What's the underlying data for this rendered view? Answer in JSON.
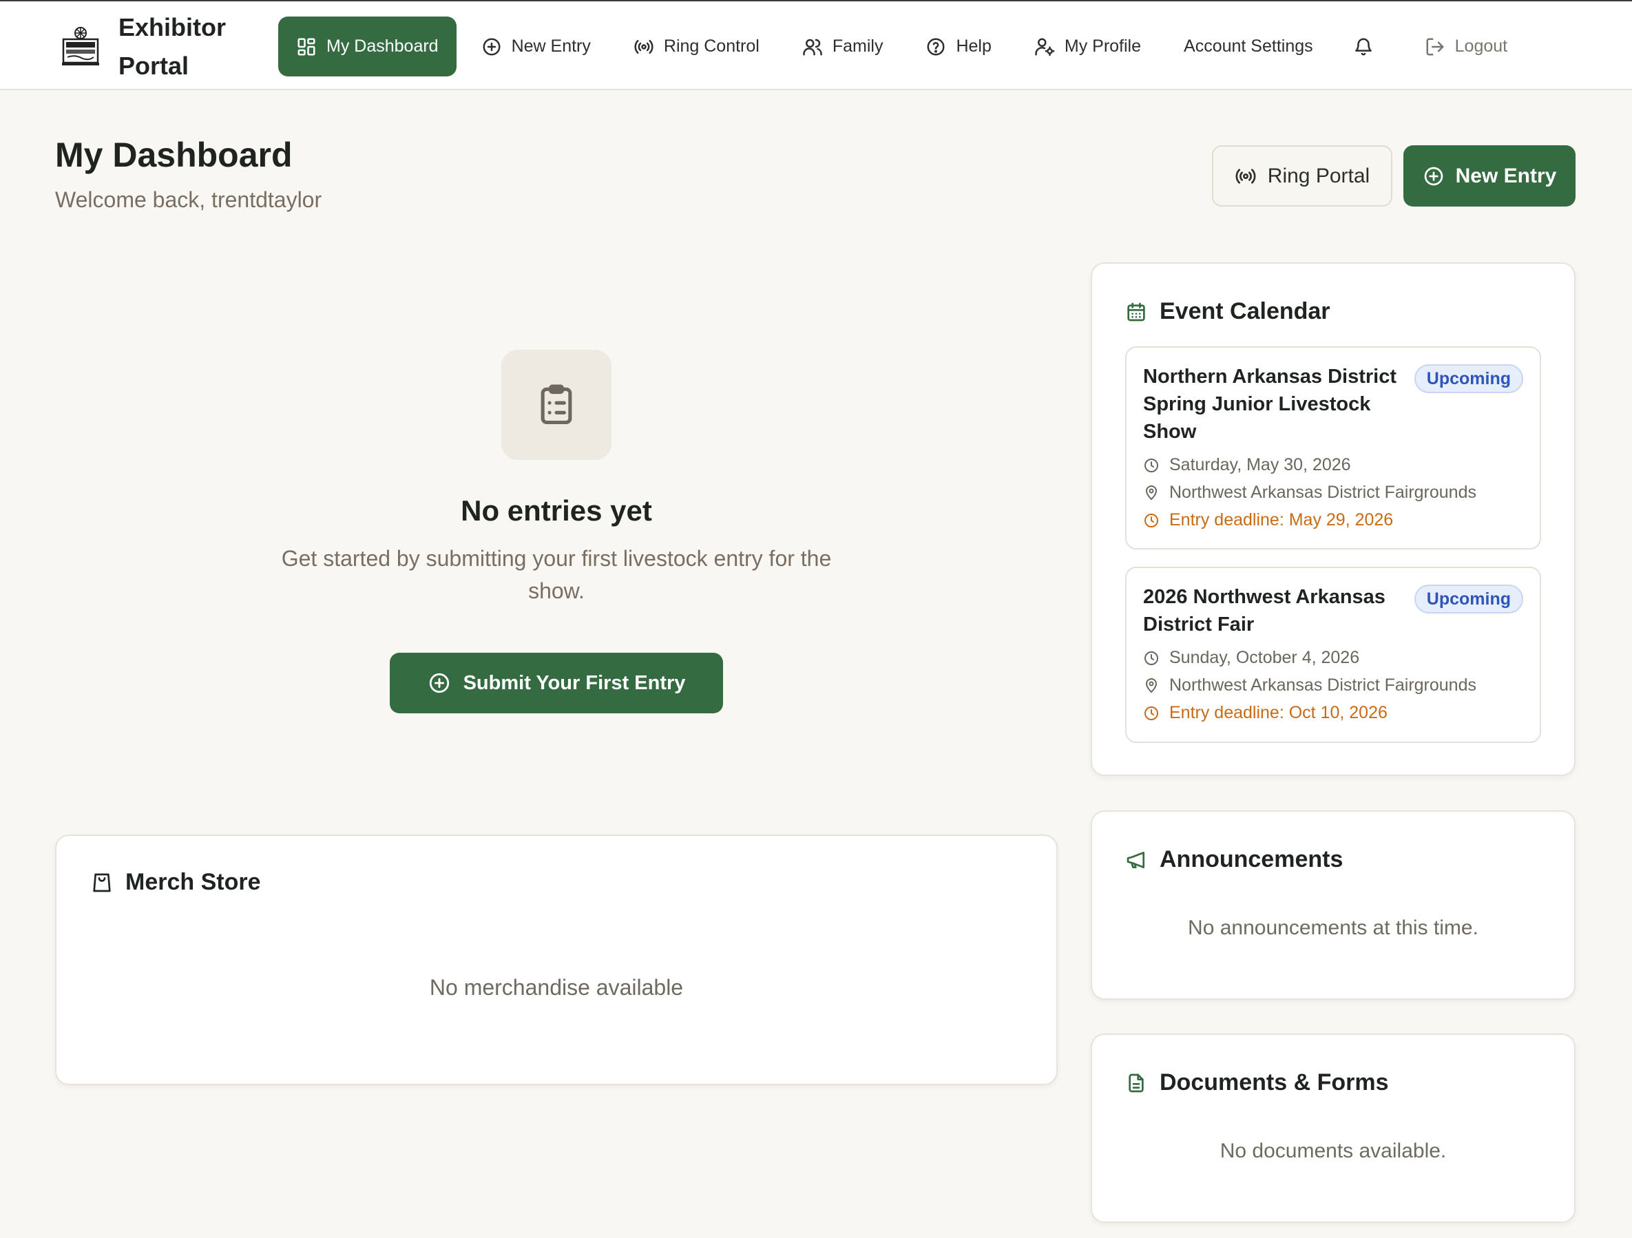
{
  "brand": {
    "title": "Exhibitor Portal"
  },
  "nav": {
    "items": [
      {
        "label": "My Dashboard",
        "icon": "dashboard-grid-icon",
        "active": true
      },
      {
        "label": "New Entry",
        "icon": "plus-circle-icon"
      },
      {
        "label": "Ring Control",
        "icon": "broadcast-icon"
      },
      {
        "label": "Family",
        "icon": "users-icon"
      },
      {
        "label": "Help",
        "icon": "question-circle-icon"
      },
      {
        "label": "My Profile",
        "icon": "user-gear-icon"
      },
      {
        "label": "Account Settings"
      }
    ],
    "bell_icon": "bell-icon",
    "logout_label": "Logout"
  },
  "header": {
    "title": "My Dashboard",
    "welcome": "Welcome back, trentdtaylor",
    "ring_portal_label": "Ring Portal",
    "new_entry_label": "New Entry"
  },
  "empty": {
    "title": "No entries yet",
    "description": "Get started by submitting your first livestock entry for the show.",
    "button_label": "Submit Your First Entry"
  },
  "merch": {
    "title": "Merch Store",
    "empty": "No merchandise available"
  },
  "calendar": {
    "title": "Event Calendar",
    "events": [
      {
        "title": "Northern Arkansas District Spring Junior Livestock Show",
        "status": "Upcoming",
        "date": "Saturday, May 30, 2026",
        "location": "Northwest Arkansas District Fairgrounds",
        "deadline": "Entry deadline: May 29, 2026"
      },
      {
        "title": "2026 Northwest Arkansas District Fair",
        "status": "Upcoming",
        "date": "Sunday, October 4, 2026",
        "location": "Northwest Arkansas District Fairgrounds",
        "deadline": "Entry deadline: Oct 10, 2026"
      }
    ]
  },
  "announcements": {
    "title": "Announcements",
    "empty": "No announcements at this time."
  },
  "documents": {
    "title": "Documents & Forms",
    "empty": "No documents available."
  },
  "colors": {
    "primary": "#356b41",
    "badge_text": "#2f55b8",
    "deadline": "#c96b14",
    "muted": "#7a6e62"
  }
}
